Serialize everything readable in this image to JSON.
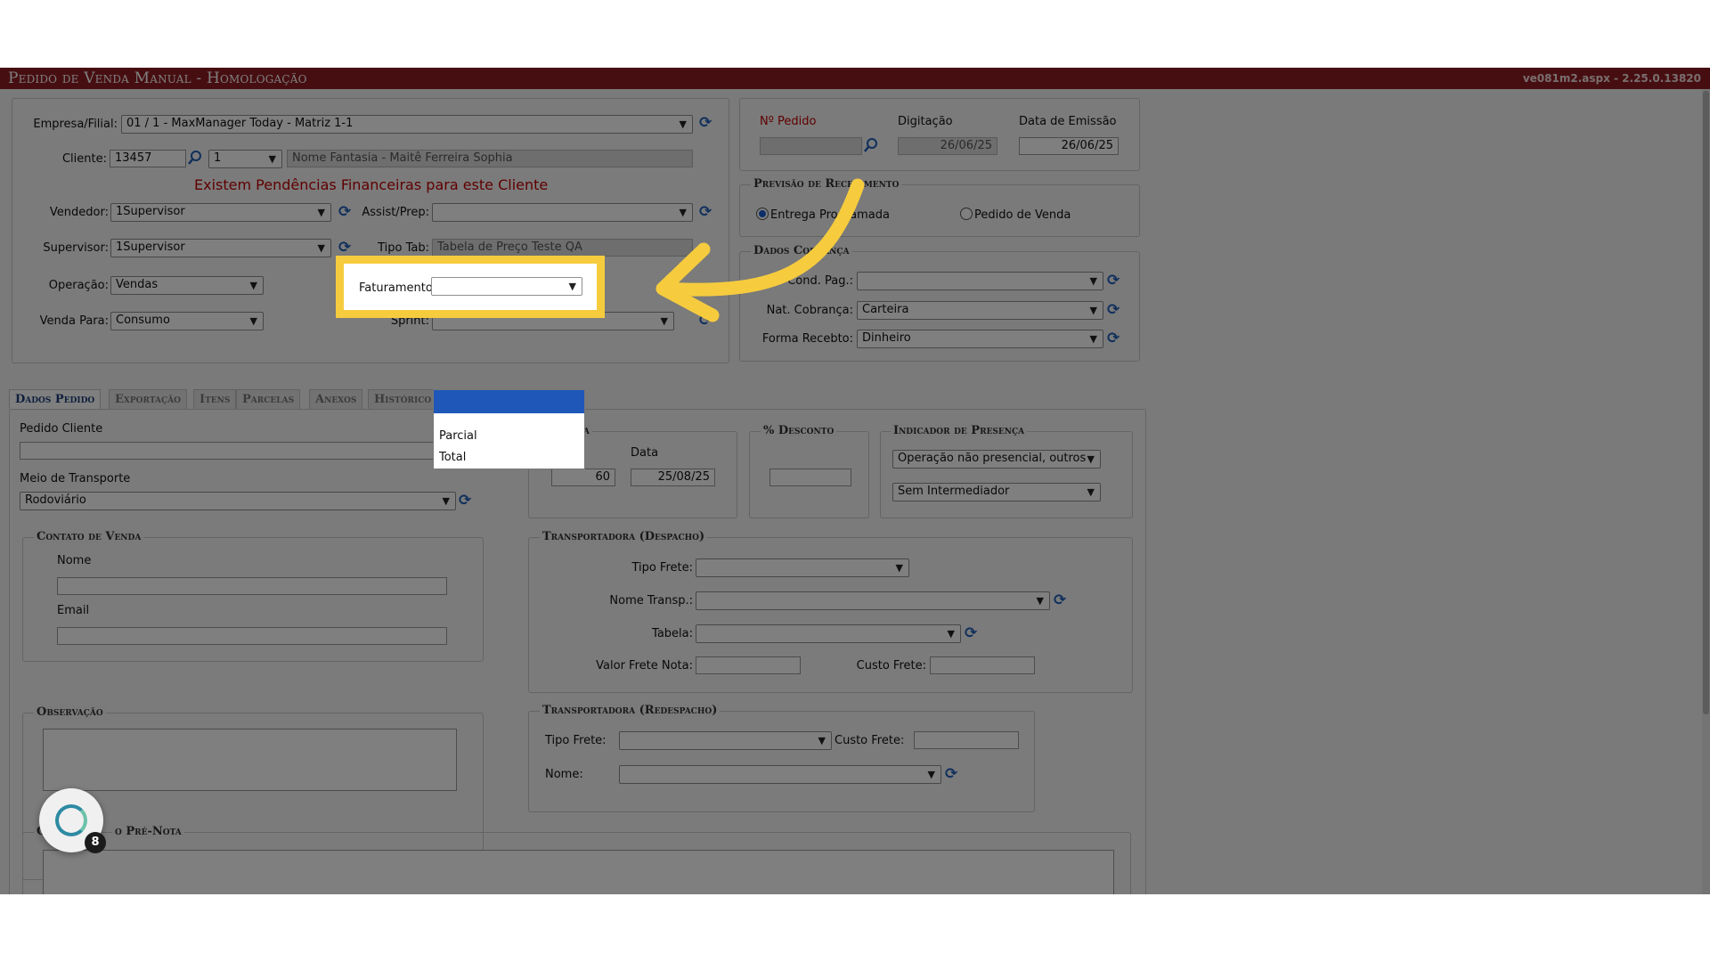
{
  "window": {
    "title": "Pedido de Venda Manual  - Homologação",
    "version": "ve081m2.aspx - 2.25.0.13820"
  },
  "header": {
    "empresa_label": "Empresa/Filial:",
    "empresa_value": "01 / 1 - MaxManager Today - Matriz 1-1",
    "cliente_label": "Cliente:",
    "cliente_code": "13457",
    "cliente_seq": "1",
    "cliente_nome": "Nome Fantasia - Maitê Ferreira Sophia",
    "pendencia_alert": "Existem Pendências Financeiras para este Cliente",
    "vendedor_label": "Vendedor:",
    "vendedor_value": "1Supervisor",
    "assist_label": "Assist/Prep:",
    "assist_value": "",
    "supervisor_label": "Supervisor:",
    "supervisor_value": "1Supervisor",
    "tipo_tab_label": "Tipo Tab:",
    "tipo_tab_value": "Tabela de Preço Teste QA",
    "operacao_label": "Operação:",
    "operacao_value": "Vendas",
    "faturamento_label": "Faturamento:",
    "faturamento_value": "",
    "venda_para_label": "Venda Para:",
    "venda_para_value": "Consumo",
    "sprint_label": "Sprint:",
    "sprint_value": ""
  },
  "pedido_info": {
    "numero_label": "Nº Pedido",
    "numero_value": "",
    "digitacao_label": "Digitação",
    "digitacao_value": "26/06/25",
    "emissao_label": "Data de Emissão",
    "emissao_value": "26/06/25"
  },
  "recebimento": {
    "legend": "Previsão de Recebimento",
    "option_entrega": "Entrega Programada",
    "option_pedido": "Pedido de Venda",
    "selected": "Entrega Programada"
  },
  "cobranca": {
    "legend": "Dados Cobrança",
    "cond_pag_label": "Cond. Pag.:",
    "cond_pag_value": "",
    "nat_cobranca_label": "Nat. Cobrança:",
    "nat_cobranca_value": "Carteira",
    "forma_recebto_label": "Forma Recebto:",
    "forma_recebto_value": "Dinheiro"
  },
  "tabs": [
    {
      "label": "Dados Pedido",
      "active": true
    },
    {
      "label": "Exportação",
      "active": false
    },
    {
      "label": "Itens",
      "active": false
    },
    {
      "label": "Parcelas",
      "active": false
    },
    {
      "label": "Anexos",
      "active": false
    },
    {
      "label": "Histórico",
      "active": false
    }
  ],
  "faturamento_options": [
    "",
    "Parcial",
    "Total"
  ],
  "dados_pedido": {
    "pedido_cliente_label": "Pedido Cliente",
    "pedido_cliente_value": "",
    "meio_transporte_label": "Meio de Transporte",
    "meio_transporte_value": "Rodoviário",
    "entrega_legend_fragment": "a",
    "dias_value": "60",
    "data_label": "Data",
    "data_value": "25/08/25",
    "desconto_legend": "% Desconto",
    "desconto_value": "",
    "presenca_legend": "Indicador de Presença",
    "presenca_value": "Operação não presencial, outros",
    "intermediador_value": "Sem Intermediador"
  },
  "contato": {
    "legend": "Contato de Venda",
    "nome_label": "Nome",
    "nome_value": "",
    "email_label": "Email",
    "email_value": ""
  },
  "despacho": {
    "legend": "Transportadora (Despacho)",
    "tipo_frete_label": "Tipo Frete:",
    "tipo_frete_value": "",
    "nome_transp_label": "Nome Transp.:",
    "nome_transp_value": "",
    "tabela_label": "Tabela:",
    "tabela_value": "",
    "valor_frete_label": "Valor Frete Nota:",
    "valor_frete_value": "",
    "custo_frete_label": "Custo Frete:",
    "custo_frete_value": ""
  },
  "observacao": {
    "legend": "Observação",
    "value": ""
  },
  "redespacho": {
    "legend": "Transportadora (Redespacho)",
    "tipo_frete_label": "Tipo Frete:",
    "tipo_frete_value": "",
    "custo_frete_label": "Custo Frete:",
    "custo_frete_value": "",
    "nome_label": "Nome:",
    "nome_value": ""
  },
  "pre_nota": {
    "legend_start": "O",
    "legend_end": "o Pré-Nota"
  },
  "assistant": {
    "badge_count": "8"
  },
  "colors": {
    "titlebar": "#8e1c22",
    "highlight": "#f6cc3e",
    "arrow": "#f6cc3e",
    "alert": "#c00000",
    "selection": "#1e57b8"
  }
}
